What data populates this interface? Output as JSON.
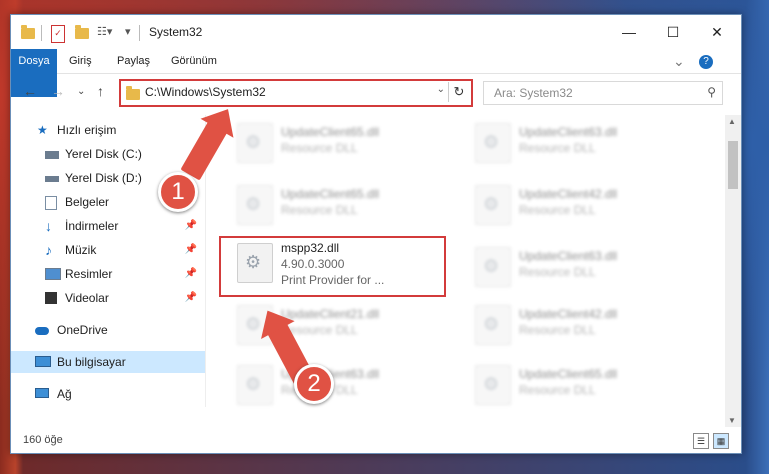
{
  "window": {
    "title": "System32",
    "minimize_glyph": "—",
    "maximize_glyph": "☐",
    "close_glyph": "✕"
  },
  "ribbon": {
    "tabs": [
      "Dosya",
      "Giriş",
      "Paylaş",
      "Görünüm"
    ],
    "collapse_glyph": "⌄",
    "help_glyph": "?"
  },
  "nav": {
    "back": "←",
    "forward": "→",
    "recent": "⌄",
    "up": "↑",
    "address": "C:\\Windows\\System32",
    "address_dropdown": "⌄",
    "refresh": "↻",
    "search_placeholder": "Ara: System32",
    "search_icon": "⚲"
  },
  "sidebar": {
    "items": [
      {
        "label": "Hızlı erişim",
        "icon": "star-icon",
        "pinned": false
      },
      {
        "label": "Yerel Disk (C:)",
        "icon": "drive-icon",
        "pinned": false
      },
      {
        "label": "Yerel Disk (D:)",
        "icon": "drive-icon",
        "pinned": false
      },
      {
        "label": "Belgeler",
        "icon": "documents-icon",
        "pinned": true
      },
      {
        "label": "İndirmeler",
        "icon": "download-icon",
        "pinned": true
      },
      {
        "label": "Müzik",
        "icon": "music-icon",
        "pinned": true
      },
      {
        "label": "Resimler",
        "icon": "pictures-icon",
        "pinned": true
      },
      {
        "label": "Videolar",
        "icon": "videos-icon",
        "pinned": true
      },
      {
        "label": "OneDrive",
        "icon": "cloud-icon",
        "pinned": false
      },
      {
        "label": "Bu bilgisayar",
        "icon": "computer-icon",
        "pinned": false,
        "selected": true
      },
      {
        "label": "Ağ",
        "icon": "network-icon",
        "pinned": false
      }
    ],
    "pin_glyph": "📌"
  },
  "files": [
    {
      "name": "UpdateClient65.dll",
      "desc": "Resource DLL"
    },
    {
      "name": "UpdateClient63.dll",
      "desc": "Resource DLL"
    },
    {
      "name": "UpdateClient65.dll",
      "desc": "Resource DLL"
    },
    {
      "name": "UpdateClient42.dll",
      "desc": "Resource DLL"
    },
    {
      "name": "mspp32.dll",
      "version": "4.90.0.3000",
      "desc": "Print Provider for ..."
    },
    {
      "name": "UpdateClient63.dll",
      "desc": "Resource DLL"
    },
    {
      "name": "UpdateClient21.dll",
      "desc": "Resource DLL"
    },
    {
      "name": "UpdateClient42.dll",
      "desc": "Resource DLL"
    },
    {
      "name": "UpdateClient63.dll",
      "desc": "Resource DLL"
    },
    {
      "name": "UpdateClient65.dll",
      "desc": "Resource DLL"
    }
  ],
  "status": {
    "count": "160 öğe",
    "details_view": "☰",
    "tiles_view": "▦"
  },
  "callouts": {
    "one": "1",
    "two": "2"
  },
  "colors": {
    "accent": "#1a6dbf",
    "highlight": "#d33b3b",
    "callout": "#e05244",
    "selection": "#cce8ff"
  }
}
